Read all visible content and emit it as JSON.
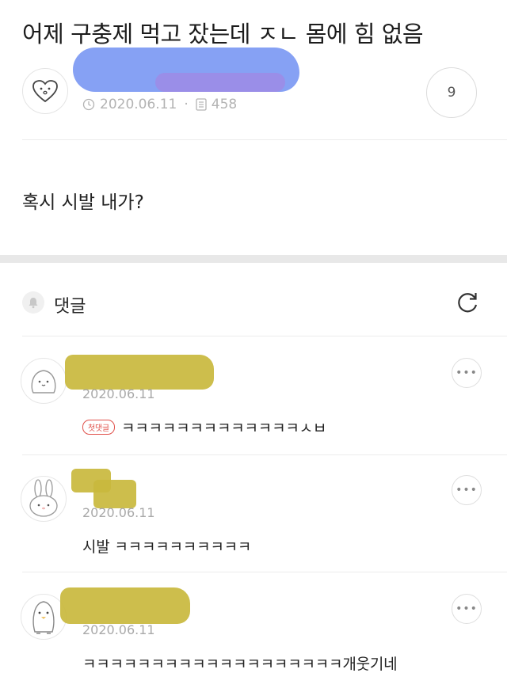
{
  "post": {
    "title": "어제 구충제 먹고 잤는데 ㅈㄴ 몸에 힘 없음",
    "date": "2020.06.11",
    "views": "458",
    "comment_count": "9",
    "body": "혹시 시발 내가?"
  },
  "comments_section": {
    "label": "댓글"
  },
  "comments": [
    {
      "date": "2020.06.11",
      "badge": "첫댓글",
      "text": "ㅋㅋㅋㅋㅋㅋㅋㅋㅋㅋㅋㅋㅋㅅㅂ",
      "avatar_icon": "blob-character-icon"
    },
    {
      "date": "2020.06.11",
      "text": "시발 ㅋㅋㅋㅋㅋㅋㅋㅋㅋㅋ",
      "avatar_icon": "rabbit-icon"
    },
    {
      "date": "2020.06.11",
      "text": "ㅋㅋㅋㅋㅋㅋㅋㅋㅋㅋㅋㅋㅋㅋㅋㅋㅋㅋㅋ개웃기네",
      "avatar_icon": "penguin-icon"
    }
  ],
  "icons": {
    "author_avatar": "heart-face-icon",
    "clock": "clock-icon",
    "views": "document-icon",
    "bell": "bell-icon",
    "refresh": "refresh-icon",
    "more": "more-dots-icon"
  },
  "colors": {
    "redaction_blue": "#7f9cf3",
    "redaction_yellow": "#c9b93d",
    "first_comment_badge": "#e0504a",
    "section_gap": "#e8e8e8"
  }
}
